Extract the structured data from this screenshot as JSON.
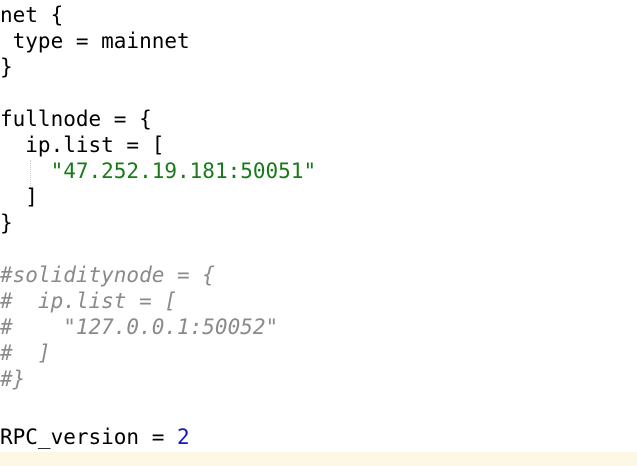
{
  "editor": {
    "lines": [
      {
        "text": "net {"
      },
      {
        "text": " type = mainnet"
      },
      {
        "text": "}"
      },
      {
        "text": ""
      },
      {
        "text": "fullnode = {"
      },
      {
        "text": "  ip.list = ["
      },
      {
        "indent": "    ",
        "string": "\"47.252.19.181:50051\""
      },
      {
        "text": "  ]"
      },
      {
        "text": "}"
      },
      {
        "text": ""
      },
      {
        "comment": "#soliditynode = {"
      },
      {
        "comment": "#  ip.list = ["
      },
      {
        "comment": "#    \"127.0.0.1:50052\""
      },
      {
        "comment": "#  ]"
      },
      {
        "comment": "#}"
      },
      {
        "text": ""
      },
      {
        "prefix": "RPC_version = ",
        "number": "2"
      }
    ],
    "colors": {
      "string": "#1a7a1a",
      "comment": "#8a8a8a",
      "number": "#1515c8",
      "current_line": "#fdf8e3"
    }
  }
}
